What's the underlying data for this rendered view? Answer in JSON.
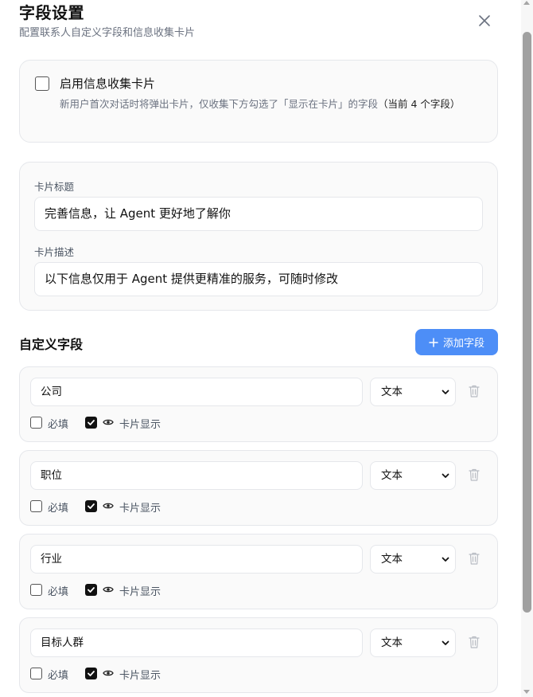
{
  "header": {
    "title": "字段设置",
    "subtitle": "配置联系人自定义字段和信息收集卡片"
  },
  "enable": {
    "label": "启用信息收集卡片",
    "desc": "新用户首次对话时将弹出卡片，仅收集下方勾选了「显示在卡片」的字段",
    "count": "（当前 4 个字段）",
    "checked": false
  },
  "card": {
    "title_label": "卡片标题",
    "title_value": "完善信息，让 Agent 更好地了解你",
    "desc_label": "卡片描述",
    "desc_value": "以下信息仅用于 Agent 提供更精准的服务，可随时修改"
  },
  "fields_section": {
    "title": "自定义字段",
    "add_label": "添加字段"
  },
  "fields": [
    {
      "name": "公司",
      "type": "文本",
      "required_label": "必填",
      "required": false,
      "show_label": "卡片显示",
      "show": true
    },
    {
      "name": "职位",
      "type": "文本",
      "required_label": "必填",
      "required": false,
      "show_label": "卡片显示",
      "show": true
    },
    {
      "name": "行业",
      "type": "文本",
      "required_label": "必填",
      "required": false,
      "show_label": "卡片显示",
      "show": true
    },
    {
      "name": "目标人群",
      "type": "文本",
      "required_label": "必填",
      "required": false,
      "show_label": "卡片显示",
      "show": true
    }
  ],
  "icons": {
    "close": "close-icon",
    "plus": "plus-icon",
    "trash": "trash-icon",
    "eye": "eye-icon",
    "chevron": "chevron-down-icon"
  },
  "colors": {
    "accent": "#4d8ef7",
    "panel_bg": "#fafafa",
    "border": "#e5e7eb"
  }
}
